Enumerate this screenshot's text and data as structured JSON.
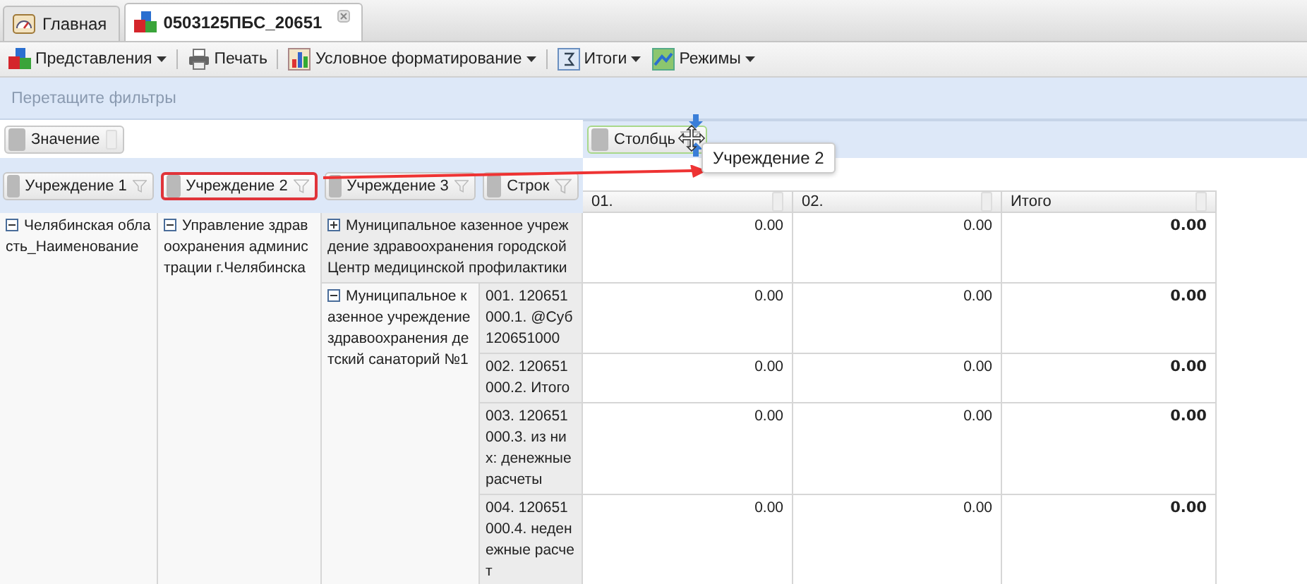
{
  "tabs": [
    {
      "label": "Главная",
      "kind": "home",
      "selected": false
    },
    {
      "label": "0503125ПБС_20651",
      "kind": "report",
      "selected": true
    }
  ],
  "toolbar": [
    {
      "label": "Представления",
      "kind": "views",
      "dropdown": true
    },
    {
      "label": "Печать",
      "kind": "print",
      "dropdown": false
    },
    {
      "label": "Условное форматирование",
      "kind": "format",
      "dropdown": true
    },
    {
      "label": "Итоги",
      "kind": "totals",
      "dropdown": true
    },
    {
      "label": "Режимы",
      "kind": "modes",
      "dropdown": true
    }
  ],
  "filter_area": {
    "placeholder": "Перетащите фильтры"
  },
  "data_fields": [
    {
      "label": "Значение"
    }
  ],
  "column_fields": [
    {
      "label": "Столбць"
    }
  ],
  "row_fields": [
    {
      "label": "Учреждение 1",
      "selected": false
    },
    {
      "label": "Учреждение 2",
      "selected": true
    },
    {
      "label": "Учреждение 3",
      "selected": false
    },
    {
      "label": "Строк",
      "selected": false
    }
  ],
  "drag_tooltip": {
    "label": "Учреждение 2"
  },
  "columns": [
    {
      "label": "01.",
      "kind": "value"
    },
    {
      "label": "02.",
      "kind": "value"
    },
    {
      "label": "Итого",
      "kind": "total"
    }
  ],
  "tree": {
    "label": "Челябинская область_Наименование",
    "expanded": true,
    "child": {
      "label": "Управление здравоохранения администрации г.Челябинска",
      "expanded": true,
      "children": [
        {
          "label": "Муниципальное казенное учреждение здравоохранения городской Центр медицинской профилактики",
          "expanded": false,
          "values": [
            "0.00",
            "0.00",
            "0.00"
          ]
        },
        {
          "label": "Муниципальное казенное учреждение здравоохранения детский санаторий №1",
          "expanded": true,
          "rows": [
            {
              "label": "001. 120651000.1. @Суб120651000",
              "values": [
                "0.00",
                "0.00",
                "0.00"
              ]
            },
            {
              "label": "002. 120651000.2. Итого",
              "values": [
                "0.00",
                "0.00",
                "0.00"
              ]
            },
            {
              "label": "003. 120651000.3. из них: денежные расчеты",
              "values": [
                "0.00",
                "0.00",
                "0.00"
              ]
            },
            {
              "label": "004. 120651000.4. неденежные расчет",
              "values": [
                "0.00",
                "0.00",
                "0.00"
              ]
            }
          ]
        }
      ]
    }
  }
}
